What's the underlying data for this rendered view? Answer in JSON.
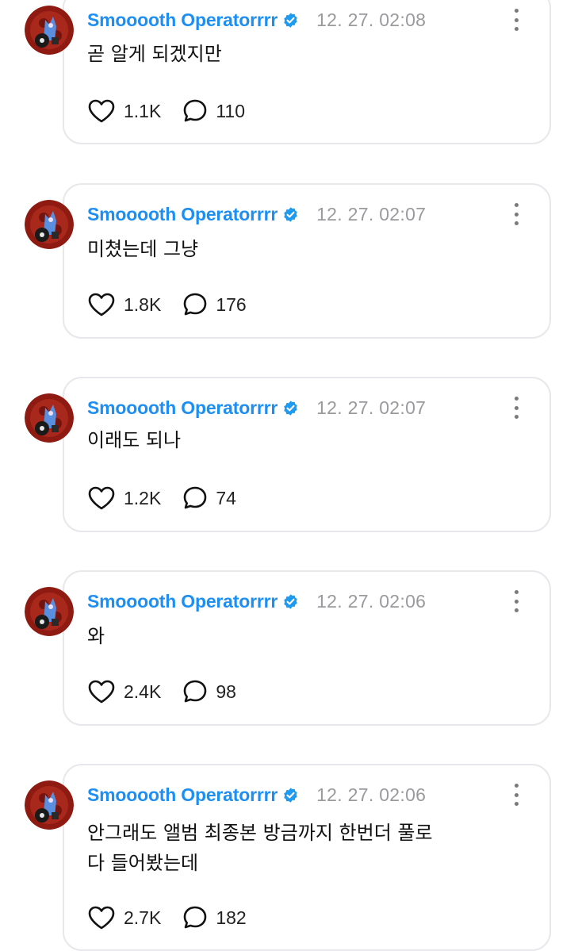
{
  "posts": [
    {
      "name": "Smooooth Operatorrrr",
      "time": "12. 27. 02:08",
      "text": "곧 알게 되겠지만",
      "likes": "1.1K",
      "comments": "110"
    },
    {
      "name": "Smooooth Operatorrrr",
      "time": "12. 27. 02:07",
      "text": "미쳤는데 그냥",
      "likes": "1.8K",
      "comments": "176"
    },
    {
      "name": "Smooooth Operatorrrr",
      "time": "12. 27. 02:07",
      "text": "이래도 되나",
      "likes": "1.2K",
      "comments": "74"
    },
    {
      "name": "Smooooth Operatorrrr",
      "time": "12. 27. 02:06",
      "text": "와",
      "likes": "2.4K",
      "comments": "98"
    },
    {
      "name": "Smooooth Operatorrrr",
      "time": "12. 27. 02:06",
      "text": "안그래도 앨범 최종본 방금까지 한번더 풀로\n다 들어봤는데",
      "likes": "2.7K",
      "comments": "182"
    }
  ],
  "icons": {
    "like": "heart-icon",
    "comment": "speech-bubble-icon",
    "verified": "verified-badge-icon",
    "more": "vertical-ellipsis-icon"
  },
  "colors": {
    "name": "#1d8ff2",
    "verified": "#1d9bf0",
    "time": "#9a9a9e",
    "border": "#e8e8ec"
  }
}
